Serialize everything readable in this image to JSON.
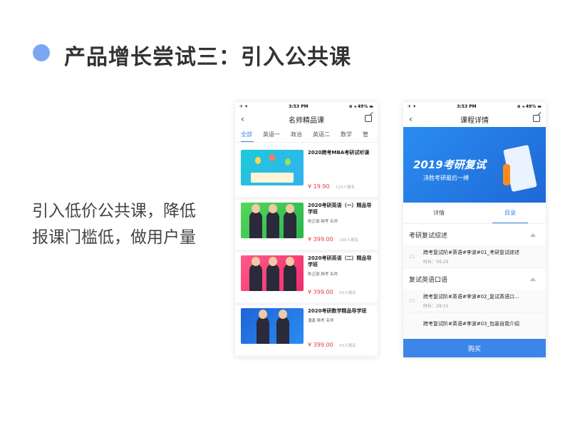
{
  "slide": {
    "title": "产品增长尝试三：引入公共课",
    "description": "引入低价公共课，降低报课门槛低，做用户量"
  },
  "status_bar": {
    "left": "✈ ✦",
    "time": "3:53 PM",
    "right": "⊕ ◂ 49% ▬"
  },
  "left_phone": {
    "nav_title": "名师精品课",
    "tabs": [
      "全部",
      "英语一",
      "政治",
      "英语二",
      "数学",
      "管"
    ],
    "active_tab": "全部",
    "courses": [
      {
        "title": "2020跨考MBA考研试听课",
        "teacher": "",
        "price": "¥ 19.90",
        "count": "115人报名"
      },
      {
        "title": "2020考研英语（一）精品导学班",
        "teacher": "陈正康   跨考 名师",
        "price": "¥ 399.00",
        "count": "156人报名"
      },
      {
        "title": "2020考研英语（二）精品导学班",
        "teacher": "陈正康   跨考 名师",
        "price": "¥ 399.00",
        "count": "50人报名"
      },
      {
        "title": "2020考研数学精品导学班",
        "teacher": "潘鑫   跨考 名师",
        "price": "¥ 399.00",
        "count": "43人报名"
      }
    ]
  },
  "right_phone": {
    "nav_title": "课程详情",
    "banner_title": "2019考研复试",
    "banner_subtitle": "决胜考研最后一搏",
    "tabs": [
      "详情",
      "目录"
    ],
    "active_tab": "目录",
    "sections": [
      {
        "title": "考研复试综述",
        "lessons": [
          {
            "num": "01",
            "title": "跨考复试阶#英语#李波#01_考研复试综述",
            "time": "时长：09:29"
          }
        ]
      },
      {
        "title": "复试英语口语",
        "lessons": [
          {
            "num": "01",
            "title": "跨考复试阶#英语#李波#02_复试英语口...",
            "time": "时长：29:15"
          },
          {
            "num": "",
            "title": "跨考复试阶#英语#李波#03_包装自我介绍",
            "time": ""
          }
        ]
      }
    ],
    "buy_label": "购买"
  }
}
